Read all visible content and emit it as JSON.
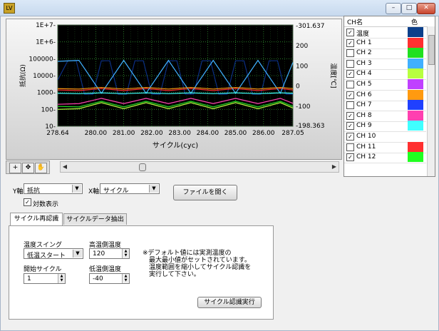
{
  "titlebar": {
    "icon_text": "LV",
    "min": "–",
    "max": "□",
    "close": "✕"
  },
  "chart": {
    "left_axis_label": "抵抗(Ω)",
    "right_axis_label": "温度[℃]",
    "x_axis_label": "サイクル(cyc)",
    "x_ticks": [
      "278.64",
      "280.00",
      "281.00",
      "282.00",
      "283.00",
      "284.00",
      "285.00",
      "286.00",
      "287.05"
    ],
    "y_left_ticks": [
      "1E+7-",
      "1E+6-",
      "100000-",
      "10000-",
      "1000-",
      "100-",
      "10-"
    ],
    "y_right_ticks": [
      "-301.637",
      "200",
      "100",
      "0",
      "-100",
      "-198.363"
    ]
  },
  "chart_data": {
    "type": "line",
    "xlabel": "サイクル(cyc)",
    "ylabel": "抵抗(Ω)",
    "y2label": "温度[℃]",
    "xlim": [
      278.64,
      287.05
    ],
    "ylim": [
      10,
      10000000
    ],
    "y_scale": "log",
    "y2lim": [
      -198.363,
      301.637
    ],
    "grid": true,
    "series": [
      {
        "name": "温度",
        "color": "#0b2f84",
        "axis": "y2",
        "x": [
          278.64,
          279.0,
          279.3,
          279.6,
          279.9,
          280.2,
          280.5,
          280.8,
          281.1,
          281.4,
          281.7,
          282.0,
          282.3,
          282.6,
          282.9,
          283.2,
          283.5,
          283.8,
          284.1,
          284.4,
          284.7,
          285.0,
          285.3,
          285.6,
          285.9,
          286.2,
          286.5,
          286.8,
          287.05
        ],
        "values": [
          30,
          125,
          125,
          -40,
          -40,
          125,
          125,
          -40,
          -40,
          125,
          125,
          -40,
          -40,
          125,
          125,
          -40,
          -40,
          125,
          125,
          -40,
          -40,
          125,
          125,
          -40,
          -40,
          125,
          125,
          -40,
          -40
        ]
      },
      {
        "name": "CH 1",
        "color": "#ff3030",
        "x": [
          278.64,
          279.4,
          280.2,
          281.0,
          281.8,
          282.6,
          283.4,
          284.2,
          285.0,
          285.8,
          286.6,
          287.05
        ],
        "values": [
          1400,
          1300,
          1700,
          1300,
          1700,
          1300,
          1700,
          1300,
          1700,
          1300,
          1700,
          1400
        ]
      },
      {
        "name": "CH 3",
        "color": "#40b0ff",
        "x": [
          278.64,
          279.4,
          280.2,
          281.0,
          281.8,
          282.6,
          283.4,
          284.2,
          285.0,
          285.8,
          286.6,
          287.05
        ],
        "values": [
          70000,
          80000,
          900,
          80000,
          900,
          80000,
          900,
          80000,
          900,
          80000,
          900,
          60000
        ]
      },
      {
        "name": "CH 4",
        "color": "#b8ff40",
        "x": [
          278.64,
          279.4,
          280.2,
          281.0,
          281.8,
          282.6,
          283.4,
          284.2,
          285.0,
          285.8,
          286.6,
          287.05
        ],
        "values": [
          100,
          110,
          250,
          110,
          250,
          110,
          250,
          110,
          250,
          110,
          250,
          120
        ]
      },
      {
        "name": "CH 6",
        "color": "#ff9a10",
        "x": [
          278.64,
          279.4,
          280.2,
          281.0,
          281.8,
          282.6,
          283.4,
          284.2,
          285.0,
          285.8,
          286.6,
          287.05
        ],
        "values": [
          1700,
          1600,
          2000,
          1600,
          2000,
          1600,
          2000,
          1600,
          2000,
          1600,
          2000,
          1700
        ]
      },
      {
        "name": "CH 8",
        "color": "#ff40b0",
        "x": [
          278.64,
          279.4,
          280.2,
          281.0,
          281.8,
          282.6,
          283.4,
          284.2,
          285.0,
          285.8,
          286.6,
          287.05
        ],
        "values": [
          200,
          220,
          450,
          220,
          450,
          220,
          450,
          220,
          450,
          220,
          450,
          230
        ]
      },
      {
        "name": "CH 9",
        "color": "#40ffff",
        "x": [
          278.64,
          279.4,
          280.2,
          281.0,
          281.8,
          282.6,
          283.4,
          284.2,
          285.0,
          285.8,
          286.6,
          287.05
        ],
        "values": [
          900,
          850,
          950,
          850,
          950,
          850,
          950,
          850,
          950,
          850,
          950,
          900
        ]
      },
      {
        "name": "CH 12",
        "color": "#20e020",
        "x": [
          278.64,
          279.4,
          280.2,
          281.0,
          281.8,
          282.6,
          283.4,
          284.2,
          285.0,
          285.8,
          286.6,
          287.05
        ],
        "values": [
          150,
          140,
          300,
          140,
          300,
          140,
          300,
          140,
          300,
          140,
          300,
          150
        ]
      }
    ]
  },
  "channel_list": {
    "header_name": "CH名",
    "header_color": "色",
    "items": [
      {
        "label": "温度",
        "checked": true,
        "color": "#0b3f8a"
      },
      {
        "label": "CH 1",
        "checked": true,
        "color": "#ff3030"
      },
      {
        "label": "CH 2",
        "checked": false,
        "color": "#20e020"
      },
      {
        "label": "CH 3",
        "checked": false,
        "color": "#40b0ff"
      },
      {
        "label": "CH 4",
        "checked": true,
        "color": "#b8ff40"
      },
      {
        "label": "CH 5",
        "checked": false,
        "color": "#c040ff"
      },
      {
        "label": "CH 6",
        "checked": true,
        "color": "#ff9a10"
      },
      {
        "label": "CH 7",
        "checked": false,
        "color": "#2040ff"
      },
      {
        "label": "CH 8",
        "checked": true,
        "color": "#ff40b0"
      },
      {
        "label": "CH 9",
        "checked": true,
        "color": "#40ffff"
      },
      {
        "label": "CH 10",
        "checked": true,
        "color": ""
      },
      {
        "label": "CH 11",
        "checked": false,
        "color": "#ff3030"
      },
      {
        "label": "CH 12",
        "checked": true,
        "color": "#20ff20"
      }
    ]
  },
  "controls": {
    "y_axis_label": "Y軸",
    "y_axis_value": "抵抗",
    "x_axis_label": "X軸",
    "x_axis_value": "サイクル",
    "log_label": "対数表示",
    "log_checked": true,
    "open_file": "ファイルを開く"
  },
  "tabs": [
    {
      "label": "サイクル再認識",
      "active": true
    },
    {
      "label": "サイクルデータ抽出",
      "active": false
    }
  ],
  "cycle_panel": {
    "temp_swing_label": "温度スイング",
    "temp_swing_value": "低温スタート",
    "start_cycle_label": "開始サイクル",
    "start_cycle_value": "1",
    "high_temp_label": "高温側温度",
    "high_temp_value": "120",
    "low_temp_label": "低温側温度",
    "low_temp_value": "-40",
    "note_lines": [
      "※デフォルト値には実測温度の",
      "　最大最小値がセットされています。",
      "　温度範囲を縮小してサイクル認識を",
      "　実行して下さい。"
    ],
    "run_button": "サイクル認識実行"
  },
  "tools": [
    "+",
    "✥",
    "✋"
  ]
}
